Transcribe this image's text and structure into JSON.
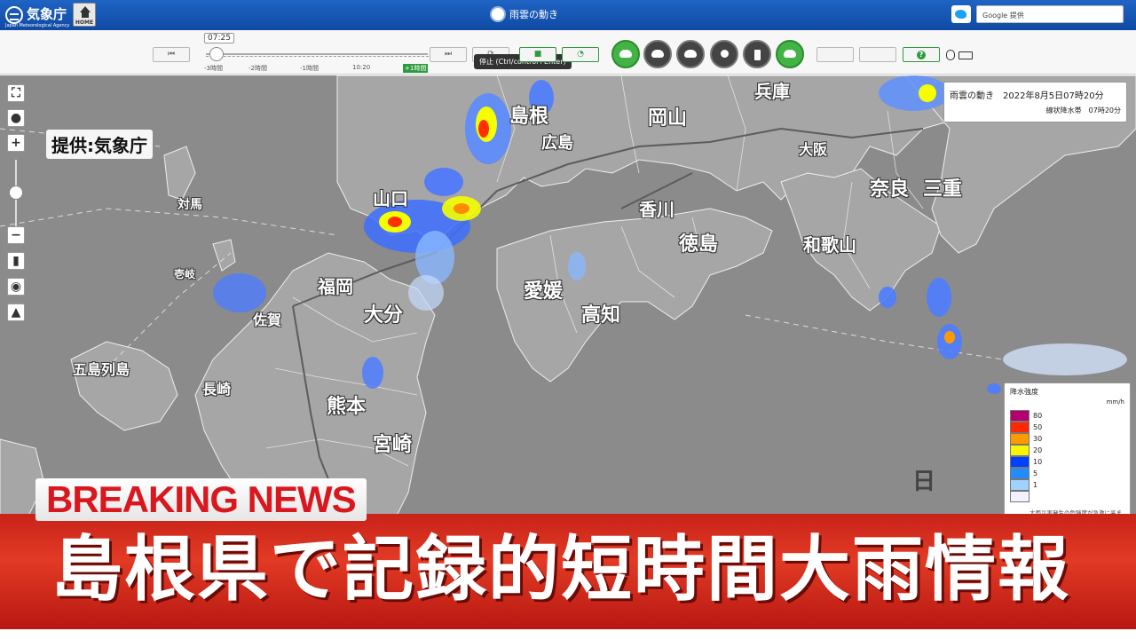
{
  "header": {
    "org_name": "気象庁",
    "org_name_en": "Japan Meteorological Agency",
    "home_label": "HOME",
    "page_title": "雨雲の動き",
    "search_label": "Google 提供"
  },
  "toolbar": {
    "current_time_bubble": "07:25",
    "tick_labels": [
      "-3時間",
      "-2時間",
      "-1時間",
      "10:20",
      "+1時間"
    ],
    "tooltip": "停止 (Ctrl/control+Enter)"
  },
  "map": {
    "credit": "提供:気象庁",
    "place_labels": [
      "島根",
      "広島",
      "岡山",
      "兵庫",
      "大阪",
      "奈良",
      "三重",
      "和歌山",
      "香川",
      "徳島",
      "愛媛",
      "高知",
      "福岡",
      "大分",
      "佐賀",
      "長崎",
      "熊本",
      "宮崎",
      "山口",
      "対馬",
      "壱岐",
      "五島列島",
      "日"
    ],
    "info_box": {
      "line1": "雨雲の動き　2022年8月5日07時20分",
      "line2": "線状降水帯　07時20分"
    },
    "legend": {
      "title": "降水強度",
      "unit": "mm/h",
      "items": [
        {
          "value": "80",
          "color": "#b4006e"
        },
        {
          "value": "50",
          "color": "#ff2800"
        },
        {
          "value": "30",
          "color": "#ff9900"
        },
        {
          "value": "20",
          "color": "#faf500"
        },
        {
          "value": "10",
          "color": "#0041ff"
        },
        {
          "value": "5",
          "color": "#218cff"
        },
        {
          "value": "1",
          "color": "#a0d2ff"
        },
        {
          "value": "",
          "color": "#f2f2ff"
        }
      ],
      "note": "大雨災害発生の危険度が急激に高まっている"
    }
  },
  "breaking": {
    "label": "BREAKING NEWS",
    "headline": "島根県で記録的短時間大雨情報"
  },
  "colors": {
    "header_blue": "#1556b8",
    "accent_green": "#2e9a3e",
    "breaking_red": "#d8181e"
  }
}
